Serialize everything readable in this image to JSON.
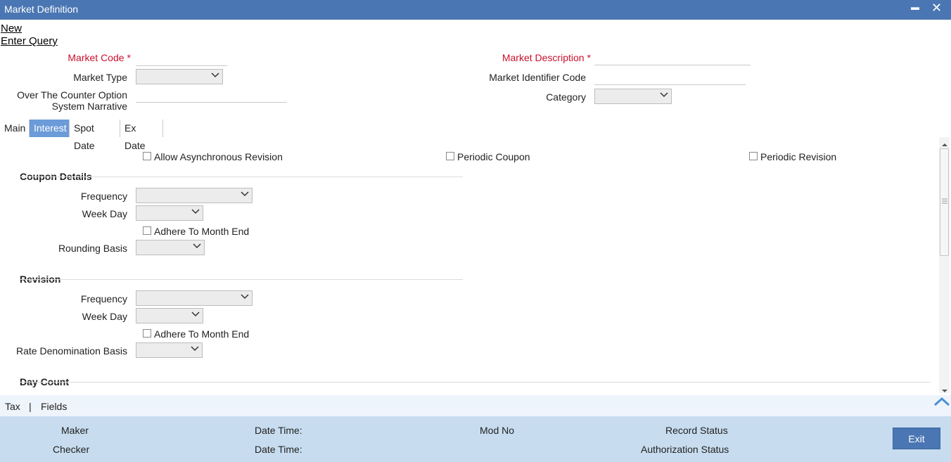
{
  "window": {
    "title": "Market Definition",
    "minimize_glyph": "▬",
    "close_glyph": "✕"
  },
  "toolbar": {
    "new_label": "New",
    "enter_query_label": "Enter Query"
  },
  "header": {
    "market_code_label": "Market Code",
    "market_code_value": "",
    "required_marker": "*",
    "market_type_label": "Market Type",
    "market_type_value": "",
    "otc_label_line1": "Over The Counter Option",
    "otc_label_line2": "System Narrative",
    "otc_value": "",
    "market_description_label": "Market Description",
    "market_description_value": "",
    "mic_label": "Market Identifier Code",
    "mic_value": "",
    "category_label": "Category",
    "category_value": ""
  },
  "tabs": [
    {
      "label": "Main",
      "active": false
    },
    {
      "label": "Interest",
      "active": true
    },
    {
      "label": "Spot Date",
      "active": false
    },
    {
      "label": "Ex Date",
      "active": false
    }
  ],
  "interest": {
    "allow_async_revision_label": "Allow Asynchronous Revision",
    "periodic_coupon_label": "Periodic Coupon",
    "periodic_revision_label": "Periodic Revision",
    "coupon_details": {
      "title": "Coupon Details",
      "frequency_label": "Frequency",
      "week_day_label": "Week Day",
      "adhere_label": "Adhere To Month End",
      "rounding_basis_label": "Rounding Basis"
    },
    "revision": {
      "title": "Revision",
      "frequency_label": "Frequency",
      "week_day_label": "Week Day",
      "adhere_label": "Adhere To Month End",
      "rate_denomination_label": "Rate Denomination Basis"
    },
    "day_count_title": "Day Count"
  },
  "bottom_links": {
    "tax": "Tax",
    "separator": "|",
    "fields": "Fields"
  },
  "footer": {
    "maker_label": "Maker",
    "checker_label": "Checker",
    "date_time_label": "Date Time:",
    "mod_no_label": "Mod No",
    "record_status_label": "Record Status",
    "auth_status_label": "Authorization Status",
    "exit_label": "Exit"
  },
  "colors": {
    "titlebar": "#4a76b3",
    "active_tab": "#6b9bd8",
    "required": "#c8102e",
    "footer": "#c7dcef",
    "accent_arrow": "#4a8fd6"
  },
  "icons": {
    "collapse": "chevron-up-icon",
    "dropdown": "chevron-down-icon"
  }
}
